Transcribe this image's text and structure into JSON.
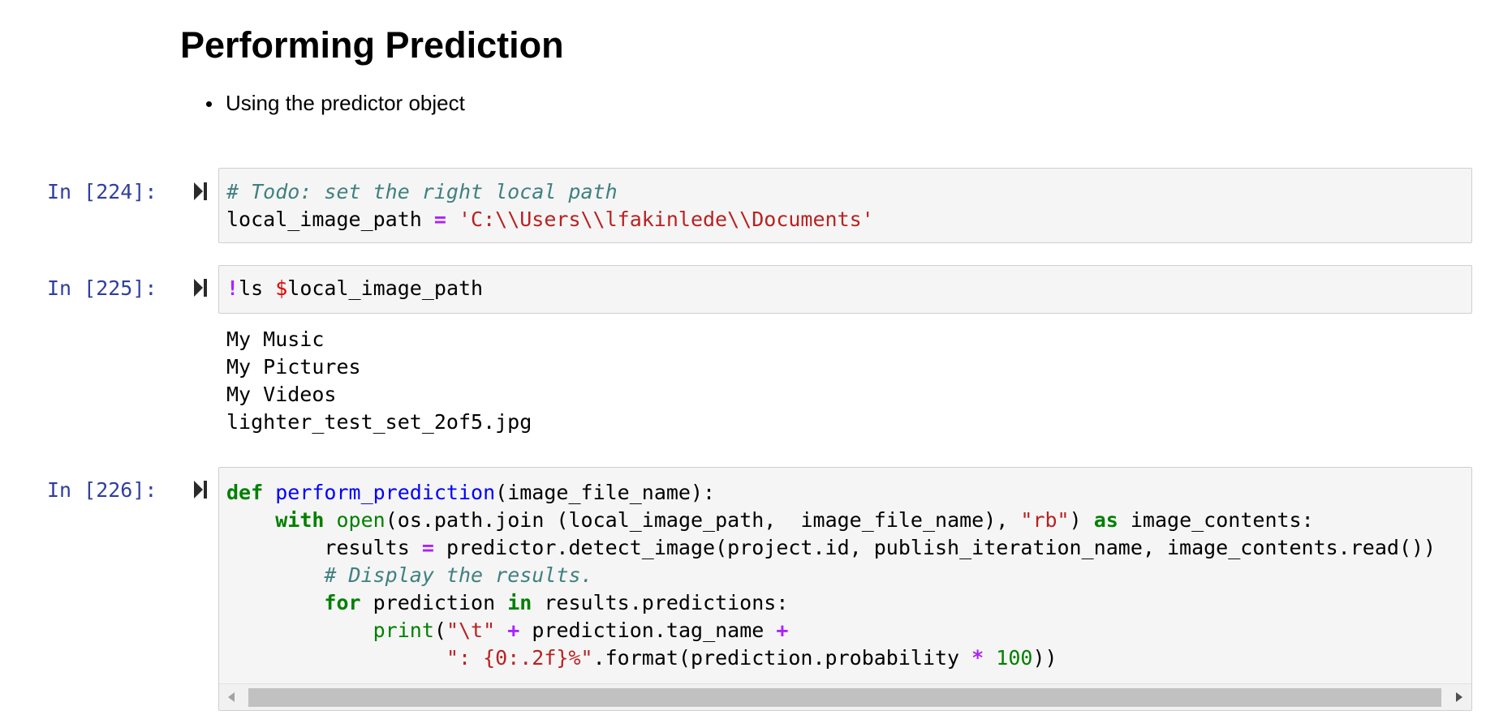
{
  "markdown": {
    "title": "Performing Prediction",
    "bullets": [
      "Using the predictor object"
    ]
  },
  "cells": [
    {
      "prompt": "In [224]:",
      "code_lines": [
        "# Todo: set the right local path",
        "local_image_path = 'C:\\\\Users\\\\lfakinlede\\\\Documents'"
      ]
    },
    {
      "prompt": "In [225]:",
      "code_lines": [
        "!ls $local_image_path"
      ],
      "output_lines": [
        "My Music",
        "My Pictures",
        "My Videos",
        "lighter_test_set_2of5.jpg"
      ]
    },
    {
      "prompt": "In [226]:",
      "code_lines": [
        "def perform_prediction(image_file_name):",
        "    with open(os.path.join (local_image_path,  image_file_name), \"rb\") as image_contents:",
        "        results = predictor.detect_image(project.id, publish_iteration_name, image_contents.read())",
        "        # Display the results.",
        "        for prediction in results.predictions:",
        "            print(\"\\t\" + prediction.tag_name +",
        "                  \": {0:.2f}%\".format(prediction.probability * 100))"
      ]
    }
  ],
  "colors": {
    "prompt": "#303f9f",
    "comment": "#408080",
    "string": "#ba2121",
    "keyword": "#008000",
    "function": "#0000ff",
    "operator": "#aa22ff",
    "cell_background": "#f5f5f5"
  },
  "icons": {
    "run": "skip-next-icon",
    "scroll_left": "triangle-left-icon",
    "scroll_right": "triangle-right-icon"
  }
}
